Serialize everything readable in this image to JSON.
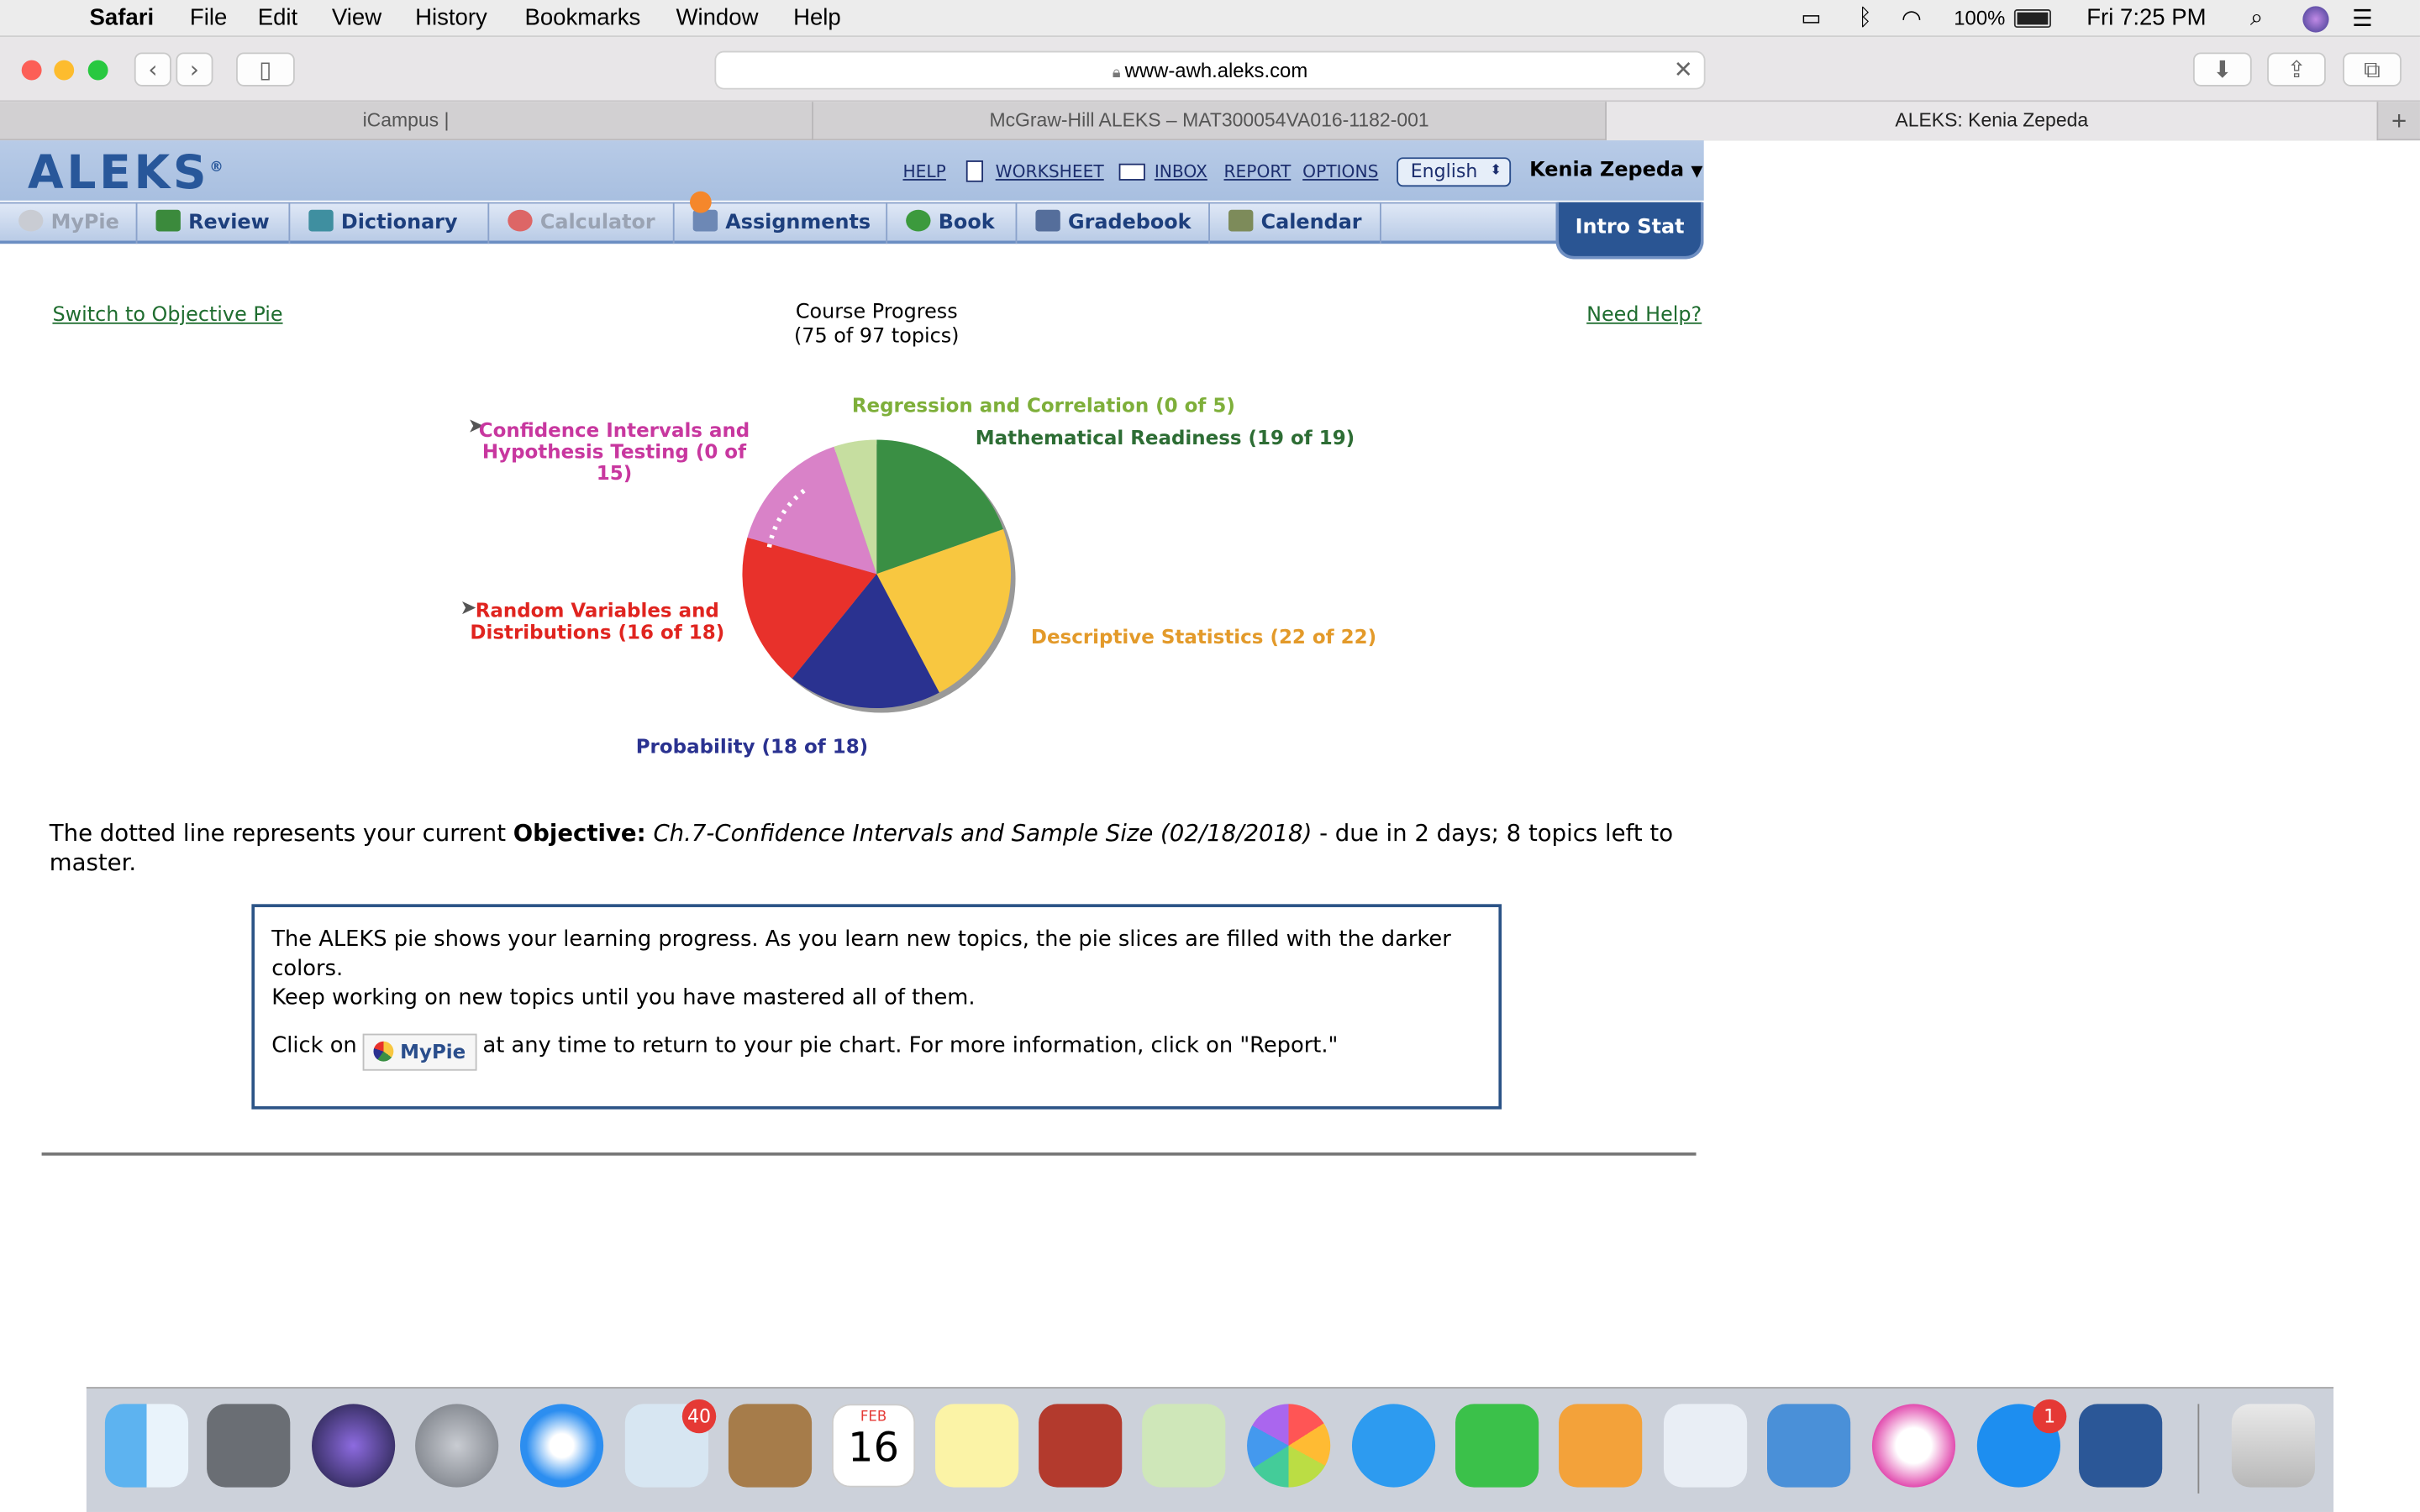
{
  "menubar": {
    "app": "Safari",
    "items": [
      "File",
      "Edit",
      "View",
      "History",
      "Bookmarks",
      "Window",
      "Help"
    ],
    "battery": "100%",
    "clock": "Fri 7:25 PM"
  },
  "browser": {
    "url": "www-awh.aleks.com",
    "tabs": [
      "iCampus |",
      "McGraw-Hill ALEKS – MAT300054VA016-1182-001",
      "ALEKS: Kenia Zepeda"
    ]
  },
  "aleks": {
    "logo": "ALEKS",
    "registered": "®",
    "links": {
      "help": "HELP",
      "worksheet": "WORKSHEET",
      "inbox": "INBOX",
      "report": "REPORT",
      "options": "OPTIONS"
    },
    "language": "English",
    "user": "Kenia Zepeda",
    "nav": [
      "MyPie",
      "Review",
      "Dictionary",
      "Calculator",
      "Assignments",
      "Book",
      "Gradebook",
      "Calendar"
    ],
    "course": "Intro Stat"
  },
  "content": {
    "switch_link": "Switch to Objective Pie",
    "help_link": "Need Help?",
    "progress_title": "Course Progress",
    "progress_sub": "(75 of 97 topics)"
  },
  "chart_data": {
    "type": "pie",
    "title": "Course Progress",
    "subtitle": "(75 of 97 topics)",
    "slices": [
      {
        "name": "Mathematical Readiness",
        "label": "Mathematical Readiness (19 of 19)",
        "mastered": 19,
        "total": 19,
        "color": "#3a8f44"
      },
      {
        "name": "Descriptive Statistics",
        "label": "Descriptive Statistics (22 of 22)",
        "mastered": 22,
        "total": 22,
        "color": "#f8c740"
      },
      {
        "name": "Probability",
        "label": "Probability (18 of 18)",
        "mastered": 18,
        "total": 18,
        "color": "#2a3290"
      },
      {
        "name": "Random Variables and Distributions",
        "label_line1": "Random Variables and",
        "label_line2": "Distributions (16 of 18)",
        "mastered": 16,
        "total": 18,
        "color": "#e8312b"
      },
      {
        "name": "Confidence Intervals and Hypothesis Testing",
        "label_line1": "Confidence Intervals and",
        "label_line2": "Hypothesis Testing (0 of 15)",
        "mastered": 0,
        "total": 15,
        "color": "#d982c8"
      },
      {
        "name": "Regression and Correlation",
        "label": "Regression and Correlation (0 of 5)",
        "mastered": 0,
        "total": 5,
        "color": "#c6dea0"
      }
    ],
    "label_colors": {
      "math": "#2d6d34",
      "desc": "#e39a2a",
      "prob": "#2a3290",
      "rv": "#e0241f",
      "ci": "#c8379f",
      "reg": "#7eaf3a"
    }
  },
  "objective": {
    "pre": "The dotted line represents your current ",
    "bold": "Objective:",
    "italic": "Ch.7-Confidence Intervals and Sample Size (02/18/2018)",
    "post": " - due in 2 days; 8 topics left to master."
  },
  "info": {
    "line1": "The ALEKS pie shows your learning progress. As you learn new topics, the pie slices are filled with the darker colors.",
    "line2": "Keep working on new topics until you have mastered all of them.",
    "click_pre": "Click on",
    "button": "MyPie",
    "click_post": "at any time to return to your pie chart. For more information, click on \"Report.\""
  },
  "dock": {
    "mail_badge": "40",
    "calendar_month": "FEB",
    "calendar_day": "16",
    "appstore_badge": "1"
  }
}
